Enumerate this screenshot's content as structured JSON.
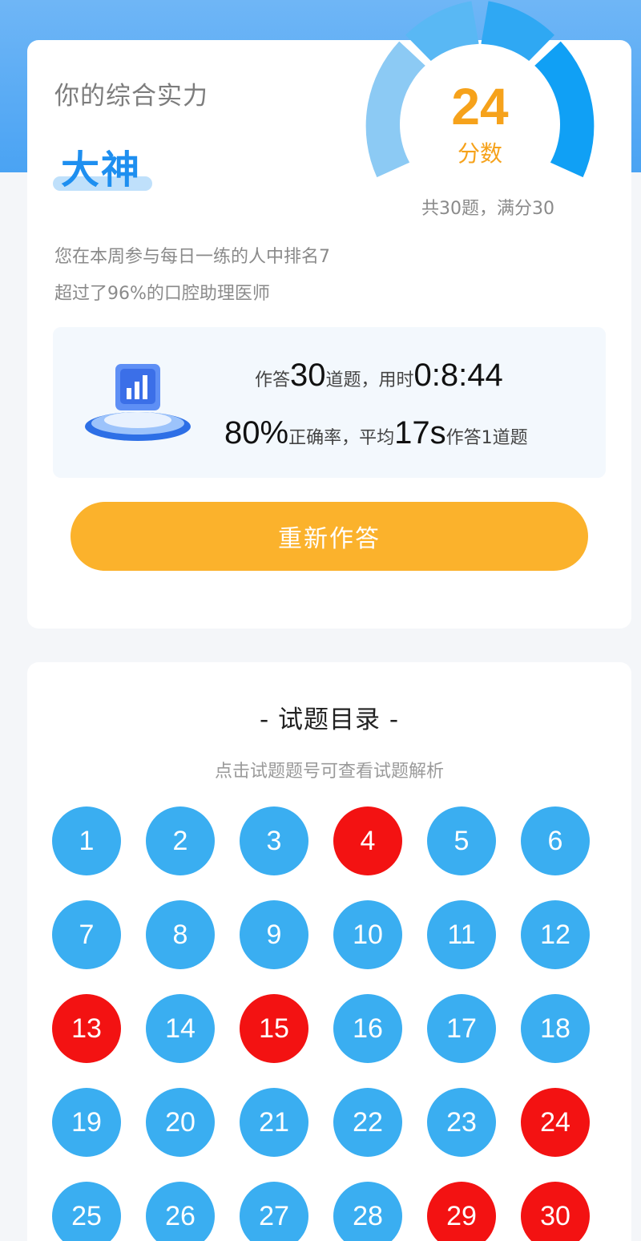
{
  "result": {
    "level_title": "你的综合实力",
    "level": "大神",
    "score": "24",
    "score_label": "分数",
    "score_total": "共30题，满分30",
    "rank_text": "您在本周参与每日一练的人中排名7",
    "surpass_text": "超过了96%的口腔助理医师"
  },
  "stats": {
    "answered_prefix": "作答",
    "answered_count": "30",
    "answered_suffix": "道题，用时",
    "time_used": "0:8:44",
    "accuracy": "80%",
    "accuracy_label": "正确率，平均",
    "avg_time": "17s",
    "avg_suffix": "作答1道题"
  },
  "retry_button": "重新作答",
  "catalog": {
    "title": "- 试题目录 -",
    "subtitle": "点击试题题号可查看试题解析",
    "questions": [
      {
        "num": "1",
        "wrong": false
      },
      {
        "num": "2",
        "wrong": false
      },
      {
        "num": "3",
        "wrong": false
      },
      {
        "num": "4",
        "wrong": true
      },
      {
        "num": "5",
        "wrong": false
      },
      {
        "num": "6",
        "wrong": false
      },
      {
        "num": "7",
        "wrong": false
      },
      {
        "num": "8",
        "wrong": false
      },
      {
        "num": "9",
        "wrong": false
      },
      {
        "num": "10",
        "wrong": false
      },
      {
        "num": "11",
        "wrong": false
      },
      {
        "num": "12",
        "wrong": false
      },
      {
        "num": "13",
        "wrong": true
      },
      {
        "num": "14",
        "wrong": false
      },
      {
        "num": "15",
        "wrong": true
      },
      {
        "num": "16",
        "wrong": false
      },
      {
        "num": "17",
        "wrong": false
      },
      {
        "num": "18",
        "wrong": false
      },
      {
        "num": "19",
        "wrong": false
      },
      {
        "num": "20",
        "wrong": false
      },
      {
        "num": "21",
        "wrong": false
      },
      {
        "num": "22",
        "wrong": false
      },
      {
        "num": "23",
        "wrong": false
      },
      {
        "num": "24",
        "wrong": true
      },
      {
        "num": "25",
        "wrong": false
      },
      {
        "num": "26",
        "wrong": false
      },
      {
        "num": "27",
        "wrong": false
      },
      {
        "num": "28",
        "wrong": false
      },
      {
        "num": "29",
        "wrong": true
      },
      {
        "num": "30",
        "wrong": true
      }
    ]
  },
  "colors": {
    "correct": "#3aaef1",
    "wrong": "#f31212",
    "accent": "#f6a21b",
    "button": "#fbb22c",
    "header": "#4aa3f3"
  }
}
